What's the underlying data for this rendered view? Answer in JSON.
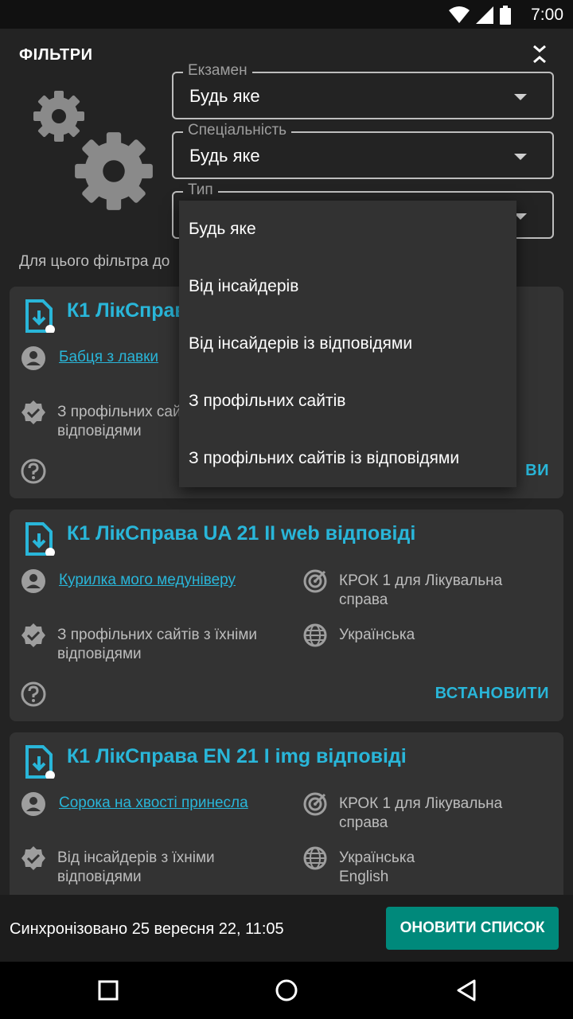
{
  "status_bar": {
    "time": "7:00"
  },
  "filters": {
    "title": "ФІЛЬТРИ",
    "exam": {
      "label": "Екзамен",
      "value": "Будь яке"
    },
    "specialty": {
      "label": "Спеціальність",
      "value": "Будь яке"
    },
    "type": {
      "label": "Тип",
      "value": ""
    },
    "note": "Для цього фільтра до"
  },
  "dropdown": {
    "options": [
      "Будь яке",
      "Від інсайдерів",
      "Від інсайдерів із відповідями",
      "З профільних сайтів",
      "З профільних сайтів із відповідями"
    ]
  },
  "cards": [
    {
      "title": "К1 ЛікСправа",
      "author": "Бабця з лавки",
      "source": "З профільних сайтів з їхніми відповідями",
      "install": "ВИ"
    },
    {
      "title": "К1 ЛікСправа UA 21 II web відповіді",
      "author": "Курилка мого медуніверу",
      "exam": "КРОК 1 для Лікувальна справа",
      "source": "З профільних сайтів з їхніми відповідями",
      "language": "Українська",
      "install": "ВСТАНОВИТИ"
    },
    {
      "title": "К1 ЛікСправа EN 21 I img відповіді",
      "author": "Сорока на хвості принесла",
      "exam": "КРОК 1 для Лікувальна справа",
      "source": "Від інсайдерів з їхніми відповідями",
      "language": "Українська English"
    }
  ],
  "bottom": {
    "sync_text": "Синхронізовано 25 вересня 22, 11:05",
    "refresh_label": "ОНОВИТИ СПИСОК"
  },
  "colors": {
    "accent": "#29b6d9",
    "primary_button": "#00897b",
    "background": "#232323",
    "card": "#333333"
  }
}
